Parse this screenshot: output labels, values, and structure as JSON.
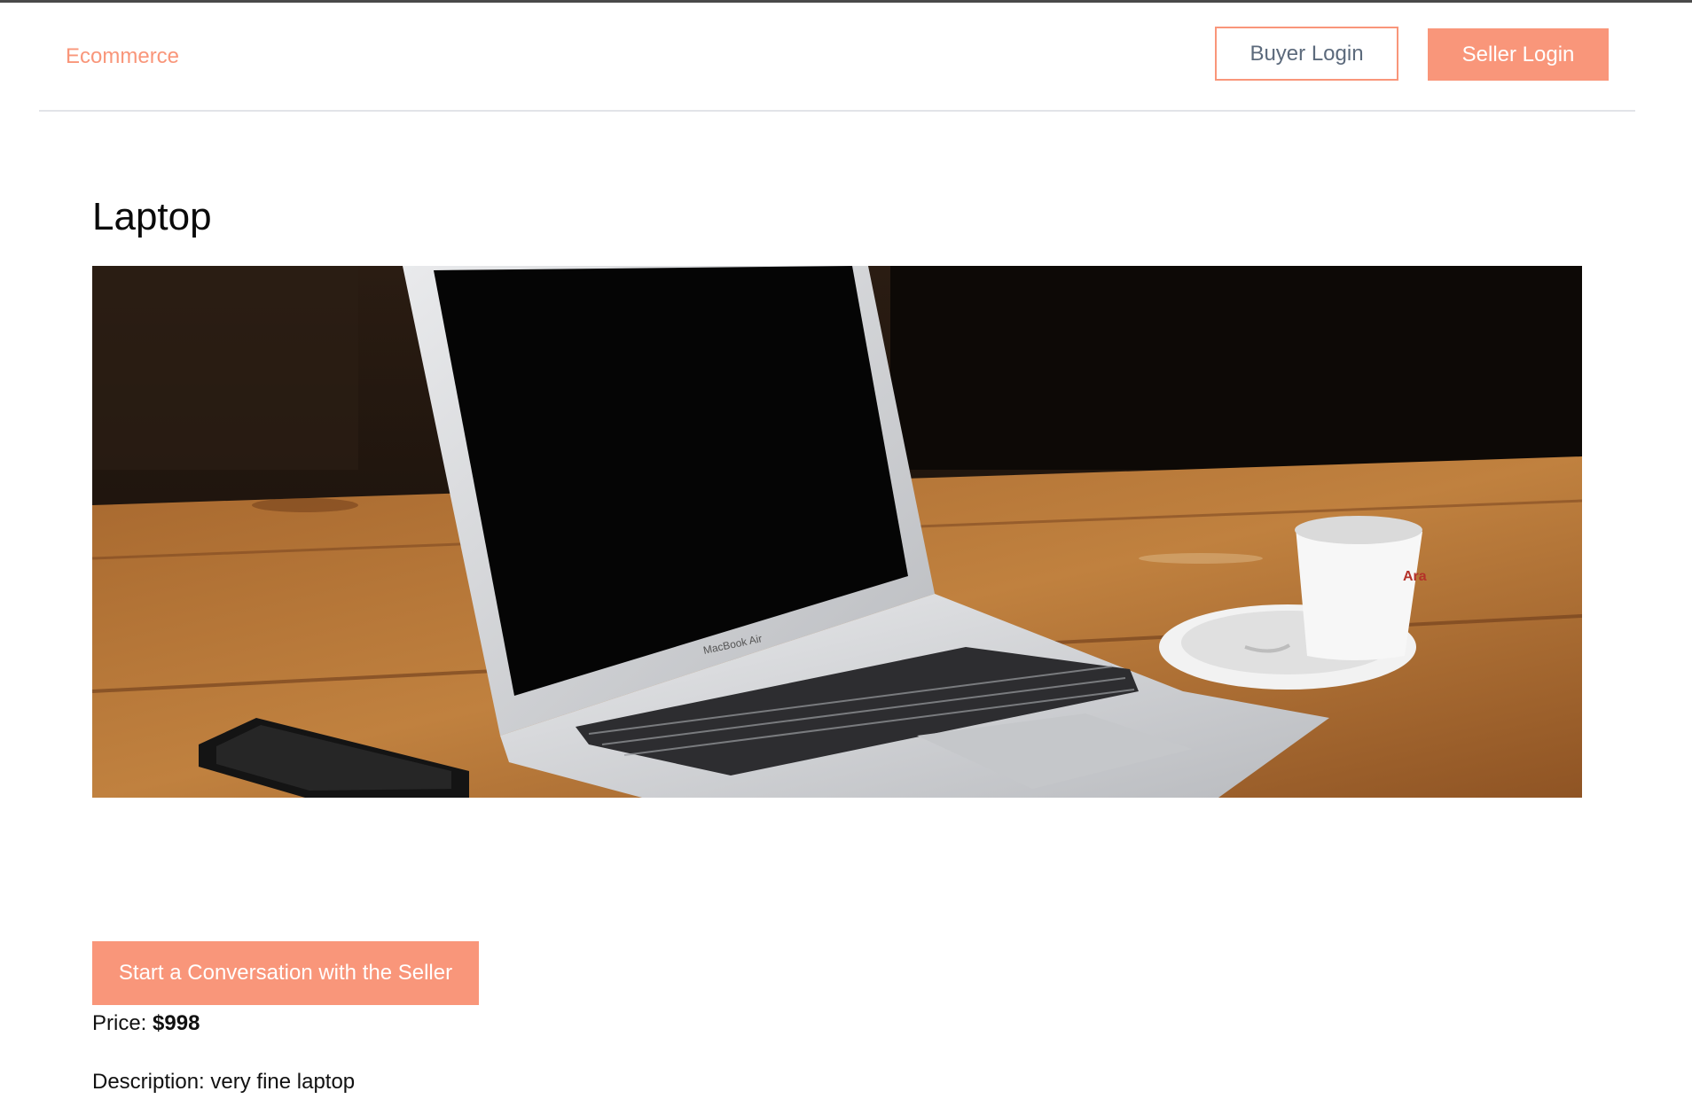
{
  "nav": {
    "brand": "Ecommerce",
    "buyer_login_label": "Buyer Login",
    "seller_login_label": "Seller Login"
  },
  "product": {
    "title": "Laptop",
    "image_alt": "Laptop",
    "laptop_brand_text": "MacBook Air",
    "cup_print_text": "Ara",
    "price_label": "Price:",
    "price_value": "$998",
    "description_label": "Description:",
    "description_value": "very fine laptop",
    "cta_label": "Start a Conversation with the Seller"
  },
  "colors": {
    "accent": "#f9967a",
    "outline_text": "#5c6a7c",
    "divider": "#e2e4e8"
  }
}
